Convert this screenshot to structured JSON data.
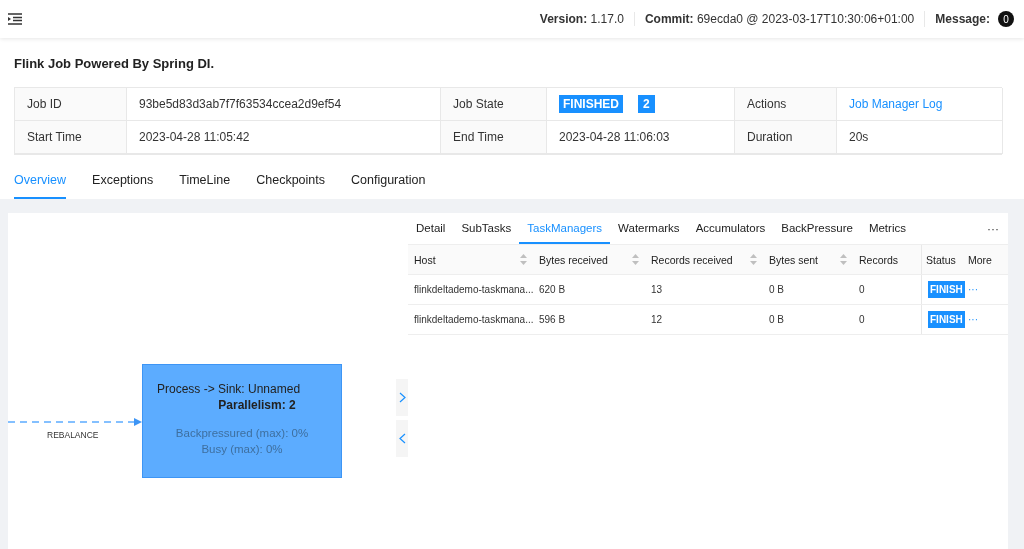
{
  "header": {
    "items": [
      {
        "label": "Version:",
        "value": "1.17.0"
      },
      {
        "label": "Commit:",
        "value": "69ecda0 @ 2023-03-17T10:30:06+01:00"
      }
    ],
    "message": {
      "label": "Message:",
      "count": "0"
    }
  },
  "job": {
    "title": "Flink Job Powered By Spring DI.",
    "info_rows": [
      [
        {
          "label": "Job ID",
          "value": "93be5d83d3ab7f7f63534ccea2d9ef54",
          "kind": "text"
        },
        {
          "label": "Job State",
          "value": "FINISHED",
          "count": "2",
          "kind": "state"
        },
        {
          "label": "Actions",
          "value": "Job Manager Log",
          "kind": "link"
        }
      ],
      [
        {
          "label": "Start Time",
          "value": "2023-04-28 11:05:42",
          "kind": "text"
        },
        {
          "label": "End Time",
          "value": "2023-04-28 11:06:03",
          "kind": "text"
        },
        {
          "label": "Duration",
          "value": "20s",
          "kind": "text"
        }
      ]
    ]
  },
  "tabs": [
    {
      "label": "Overview",
      "selected": true
    },
    {
      "label": "Exceptions",
      "selected": false
    },
    {
      "label": "TimeLine",
      "selected": false
    },
    {
      "label": "Checkpoints",
      "selected": false
    },
    {
      "label": "Configuration",
      "selected": false
    }
  ],
  "graph": {
    "edge_label": "REBALANCE",
    "node": {
      "name": "Process -> Sink: Unnamed",
      "parallelism": "Parallelism: 2",
      "metrics": [
        "Backpressured (max): 0%",
        "Busy (max): 0%"
      ]
    }
  },
  "detail": {
    "tabs": [
      {
        "label": "Detail",
        "selected": false
      },
      {
        "label": "SubTasks",
        "selected": false
      },
      {
        "label": "TaskManagers",
        "selected": true
      },
      {
        "label": "Watermarks",
        "selected": false
      },
      {
        "label": "Accumulators",
        "selected": false
      },
      {
        "label": "BackPressure",
        "selected": false
      },
      {
        "label": "Metrics",
        "selected": false
      }
    ],
    "more_tabs": "···",
    "columns": [
      {
        "label": "Host",
        "sortable": true
      },
      {
        "label": "Bytes received",
        "sortable": true
      },
      {
        "label": "Records received",
        "sortable": true
      },
      {
        "label": "Bytes sent",
        "sortable": true
      },
      {
        "label": "Records",
        "sortable": false
      }
    ],
    "fixed_columns": [
      "Status",
      "More"
    ],
    "rows": [
      {
        "cells": [
          "flinkdeltademo-taskmana...",
          "620 B",
          "13",
          "0 B",
          "0"
        ],
        "status": "FINISH",
        "more": "···"
      },
      {
        "cells": [
          "flinkdeltademo-taskmana...",
          "596 B",
          "12",
          "0 B",
          "0"
        ],
        "status": "FINISH",
        "more": "···"
      }
    ]
  }
}
